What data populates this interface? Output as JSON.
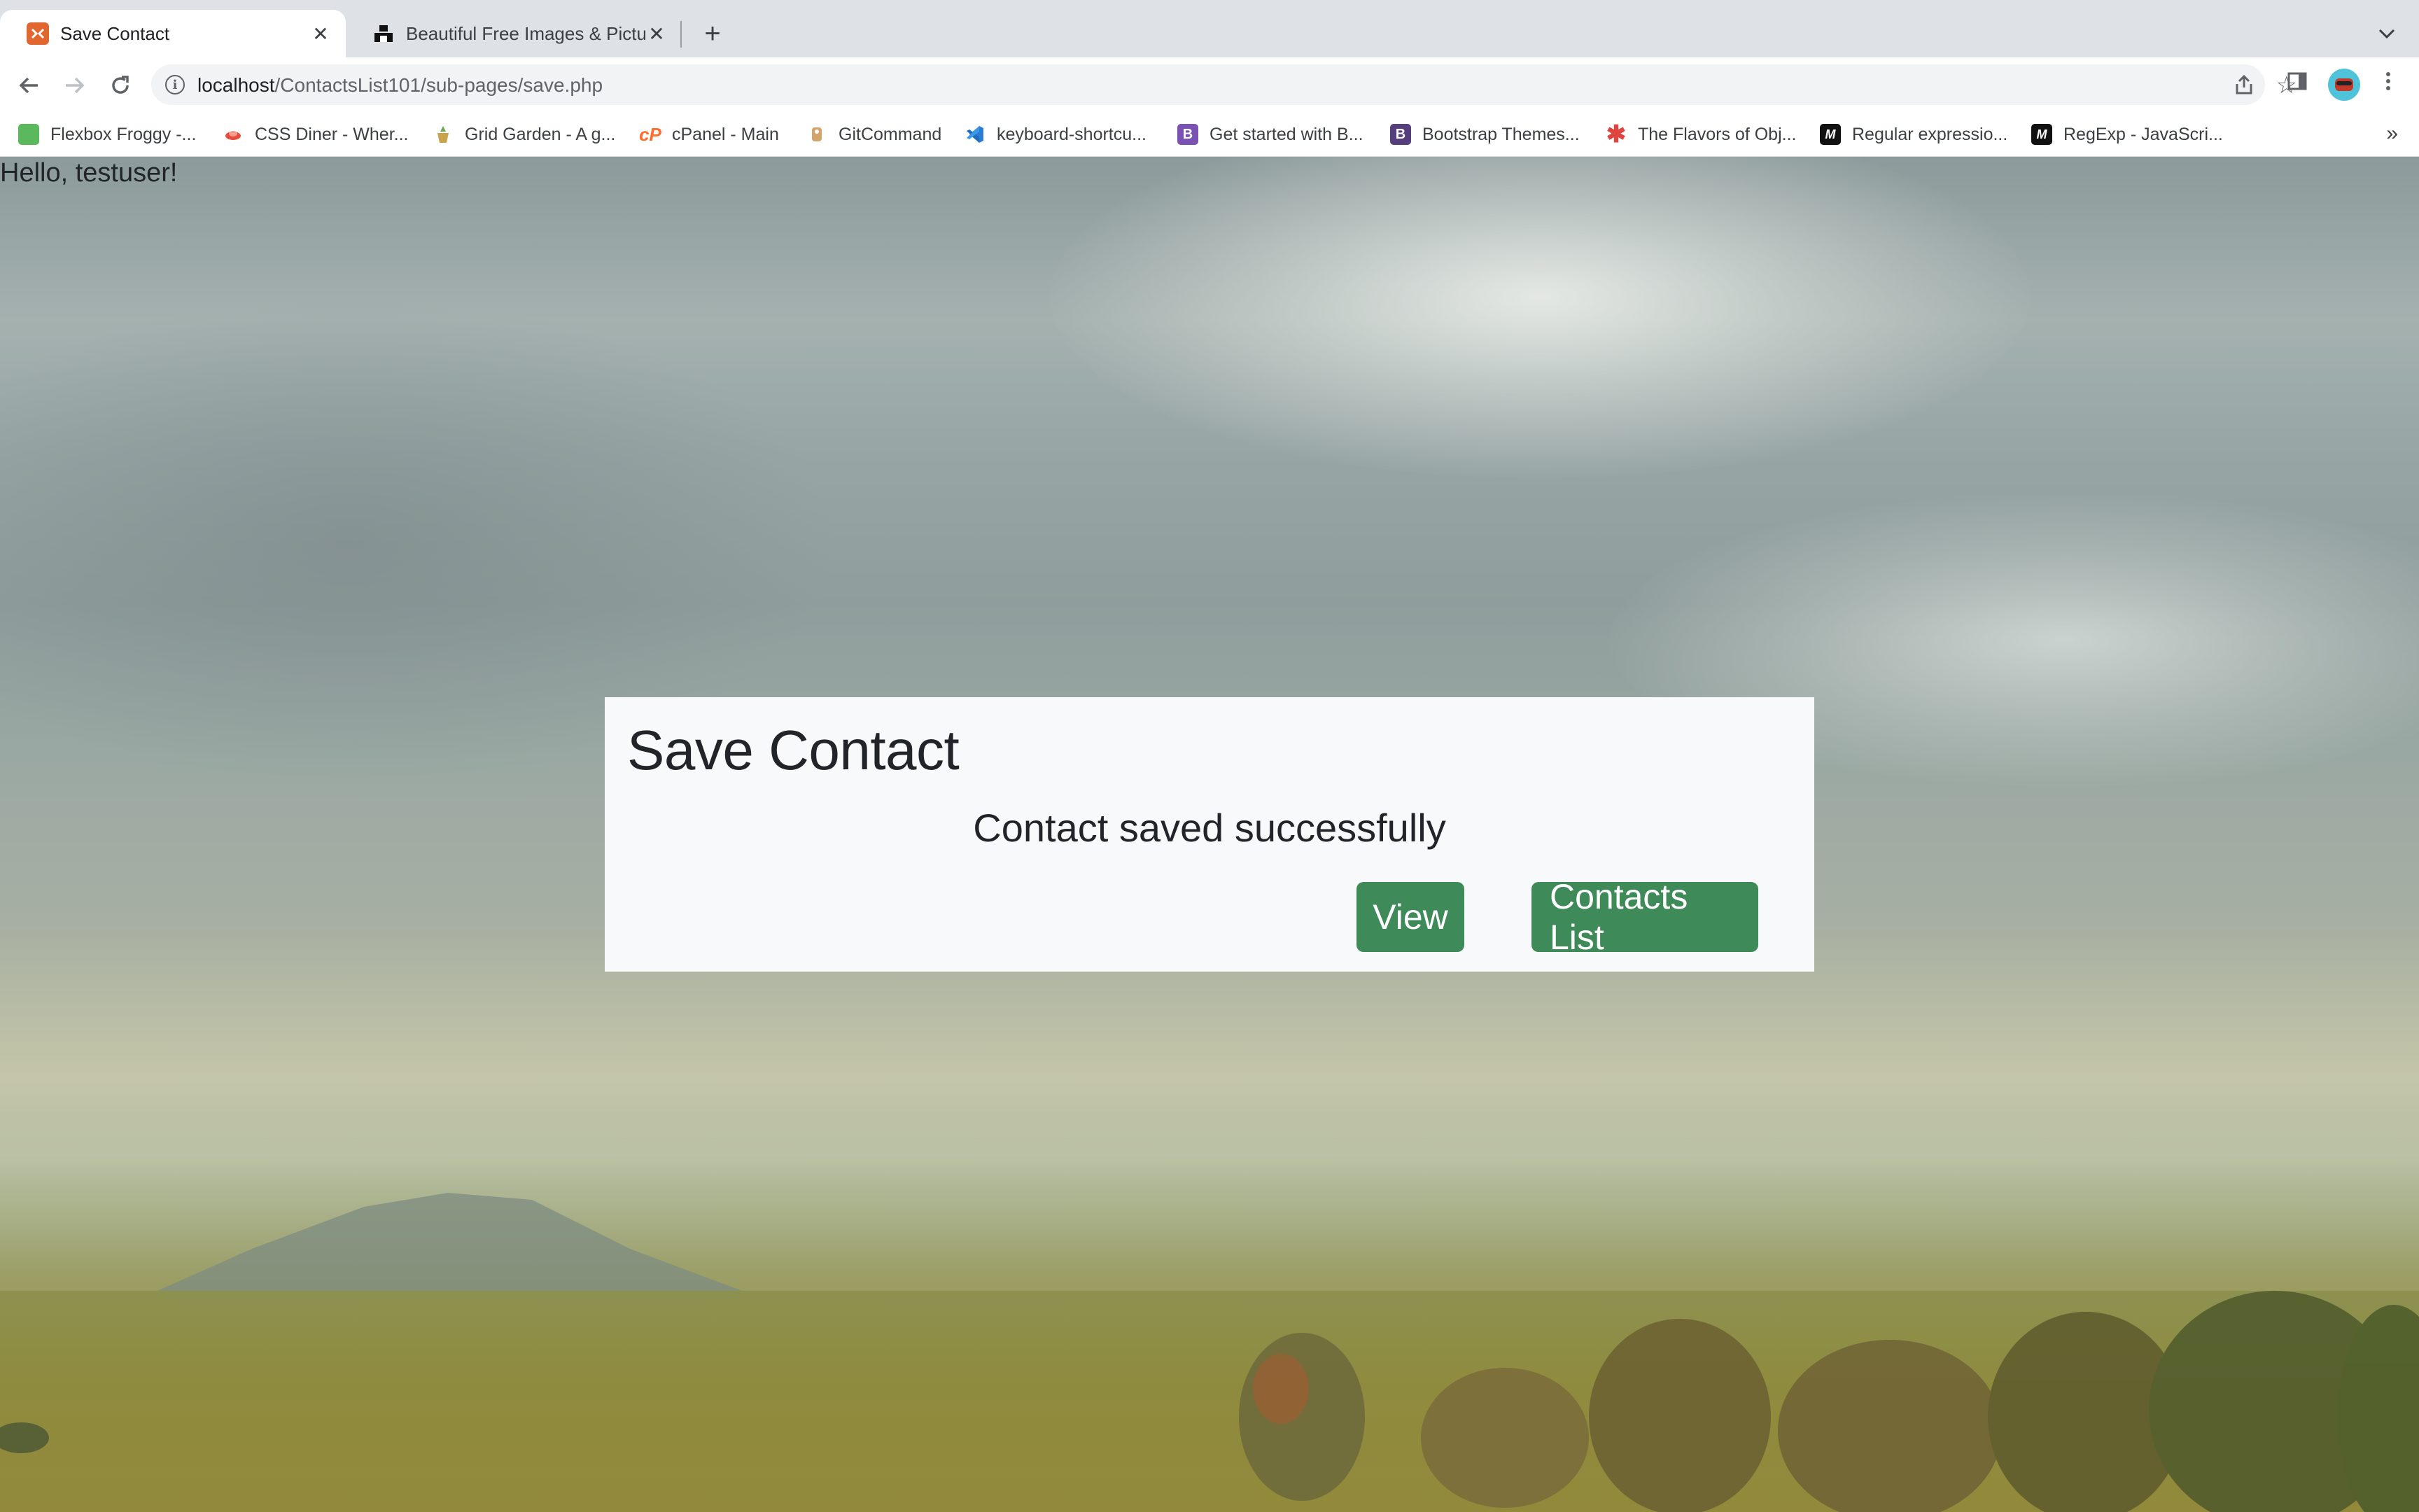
{
  "browser": {
    "tabs": [
      {
        "title": "Save Contact",
        "active": true
      },
      {
        "title": "Beautiful Free Images & Pictures",
        "active": false
      }
    ],
    "url": {
      "host": "localhost",
      "path": "/ContactsList101/sub-pages/save.php"
    },
    "bookmarks": [
      {
        "label": "Flexbox Froggy -...",
        "icon": "frog-icon",
        "color": "#5cb85c"
      },
      {
        "label": "CSS Diner - Wher...",
        "icon": "plate-icon",
        "color": "#e74c3c"
      },
      {
        "label": "Grid Garden - A g...",
        "icon": "carrot-icon",
        "color": "#c8a44d"
      },
      {
        "label": "cPanel - Main",
        "icon": "cpanel-icon",
        "color": "#ff6c2c"
      },
      {
        "label": "GitCommand",
        "icon": "git-icon",
        "color": "#d3a46b"
      },
      {
        "label": "keyboard-shortcu...",
        "icon": "vscode-icon",
        "color": "#2b7cd3"
      },
      {
        "label": "Get started with B...",
        "icon": "bootstrap-icon",
        "color": "#7952b3"
      },
      {
        "label": "Bootstrap Themes...",
        "icon": "bootstrap-themes-icon",
        "color": "#563d7c"
      },
      {
        "label": "The Flavors of Obj...",
        "icon": "asterisk-icon",
        "color": "#e0443e"
      },
      {
        "label": "Regular expressio...",
        "icon": "mdn-icon",
        "color": "#111111"
      },
      {
        "label": "RegExp - JavaScri...",
        "icon": "mdn-icon",
        "color": "#111111"
      }
    ]
  },
  "page": {
    "greeting": "Hello, testuser!",
    "card": {
      "title": "Save Contact",
      "message": "Contact saved successfully",
      "view_label": "View",
      "contacts_list_label": "Contacts List"
    }
  },
  "colors": {
    "button_green": "#3f8a59",
    "card_bg": "#f8f9fa"
  }
}
